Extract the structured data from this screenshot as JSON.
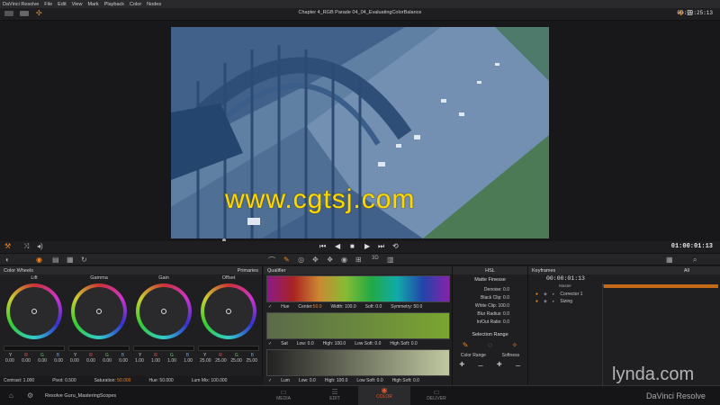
{
  "menubar": {
    "items": [
      "DaVinci Resolve",
      "File",
      "Edit",
      "View",
      "Mark",
      "Playback",
      "Color",
      "Nodes"
    ]
  },
  "toolbar": {
    "project_title": "Chapter 4_RGB Parade 04_04_EvaluatingColorBalance",
    "timecode": "00:00:25:13"
  },
  "viewer": {
    "watermark": "www.cgtsj.com"
  },
  "transport": {
    "timecode": "01:00:01:13"
  },
  "color_wheels": {
    "title": "Color Wheels",
    "mode": "Primaries",
    "wheels": [
      {
        "label": "Lift",
        "values": [
          "0.00",
          "0.00",
          "0.00",
          "0.00"
        ]
      },
      {
        "label": "Gamma",
        "values": [
          "0.00",
          "0.00",
          "0.00",
          "0.00"
        ]
      },
      {
        "label": "Gain",
        "values": [
          "1.00",
          "1.00",
          "1.00",
          "1.00"
        ]
      },
      {
        "label": "Offset",
        "values": [
          "25.00",
          "25.00",
          "25.00",
          "25.00"
        ]
      }
    ],
    "channel_letters": [
      "Y",
      "R",
      "G",
      "B"
    ],
    "contrast": "Contrast: 1.000",
    "pivot": "Pivot: 0.500",
    "saturation_label": "Saturation:",
    "saturation_value": "50.000",
    "hue": "Hue: 50.000",
    "lum_mix": "Lum Mix: 100.000"
  },
  "qualifier": {
    "title": "Qualifier",
    "hue_row": {
      "name": "Hue",
      "center_label": "Center:",
      "center_value": "50.0",
      "width": "Width: 100.0",
      "soft": "Soft: 0.0",
      "symmetry": "Symmetry: 50.0"
    },
    "sat_row": {
      "name": "Sat",
      "low": "Low: 0.0",
      "high": "High: 100.0",
      "low_soft": "Low Soft: 0.0",
      "high_soft": "High Soft: 0.0"
    },
    "lum_row": {
      "name": "Lum",
      "low": "Low: 0.0",
      "high": "High: 100.0",
      "low_soft": "Low Soft: 0.0",
      "high_soft": "High Soft: 0.0"
    }
  },
  "hsl": {
    "title": "HSL",
    "matte_finesse": "Matte Finesse",
    "rows": [
      "Denoise: 0.0",
      "Black Clip: 0.0",
      "White Clip: 100.0",
      "Blur Radius: 0.0",
      "In/Out Ratio: 0.0"
    ],
    "selection_range": "Selection Range",
    "color_range": "Color Range",
    "softness": "Softness"
  },
  "keyframes": {
    "title": "Keyframes",
    "filter": "All",
    "timecode": "00:00:01:13",
    "ruler_start": "00:00:00:00",
    "ruler_end": "00:00:00:23",
    "tracks": [
      "Master",
      "Corrector 1",
      "Sizing"
    ]
  },
  "bottom": {
    "project": "Resolve Guru_MasteringScopes",
    "pages": [
      "MEDIA",
      "EDIT",
      "COLOR",
      "DELIVER"
    ],
    "brand": "lynda.com",
    "app": "DaVinci Resolve"
  },
  "colors": {
    "accent": "#f0841e",
    "active_page": "#e8582a"
  }
}
